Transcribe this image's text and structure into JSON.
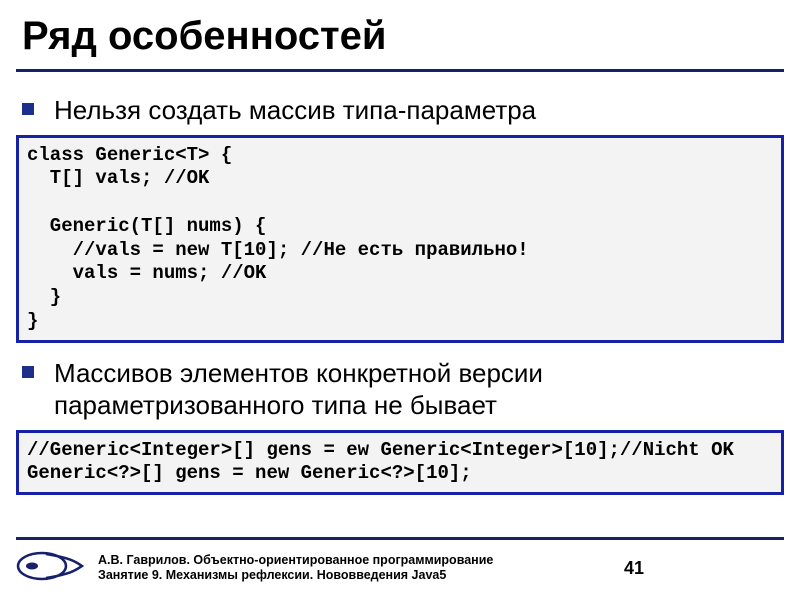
{
  "title": "Ряд особенностей",
  "bullets": {
    "b1": "Нельзя создать массив типа-параметра",
    "b2": "Массивов элементов конкретной версии параметризованного типа не бывает"
  },
  "code1": "class Generic<T> {\n  T[] vals; //OK\n\n  Generic(T[] nums) {\n    //vals = new T[10]; //Не есть правильно!\n    vals = nums; //OK\n  }\n}",
  "code2": "//Generic<Integer>[] gens = ew Generic<Integer>[10];//Nicht OK\nGeneric<?>[] gens = new Generic<?>[10];",
  "footer": {
    "line1": "А.В. Гаврилов. Объектно-ориентированное программирование",
    "line2": "Занятие 9. Механизмы рефлексии. Нововведения Java5"
  },
  "page": "41",
  "colors": {
    "accent": "#16206b",
    "codeBorder": "#1522a5",
    "codeBg": "#f3f3f3"
  }
}
